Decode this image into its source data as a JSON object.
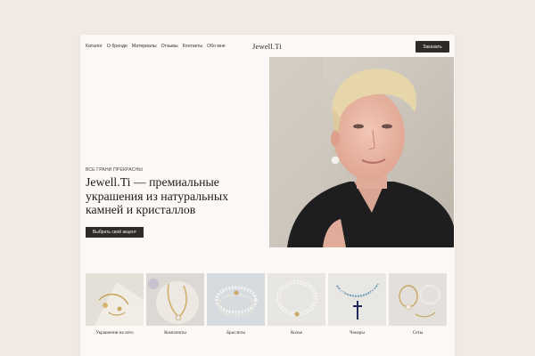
{
  "nav": {
    "links": [
      "Каталог",
      "О бренде",
      "Материалы",
      "Отзывы",
      "Контакты",
      "Обо мне"
    ],
    "logo": "Jewell.Ti",
    "order_label": "Заказать"
  },
  "hero": {
    "eyebrow": "ВСЕ ГРАНИ ПРЕКРАСНЫ",
    "headline": "Jewell.Ti — премиальные украшения из натуральных камней и кристаллов",
    "cta_label": "Выбрать свой акцент"
  },
  "categories": [
    {
      "label": "Украшения на лето"
    },
    {
      "label": "Комплекты"
    },
    {
      "label": "Браслеты"
    },
    {
      "label": "Колье"
    },
    {
      "label": "Чокеры"
    },
    {
      "label": "Сеты"
    }
  ],
  "colors": {
    "background": "#f1e9e2",
    "page": "#fbf8f5",
    "button": "#2d2a28",
    "button_text": "#f7f2ec"
  }
}
